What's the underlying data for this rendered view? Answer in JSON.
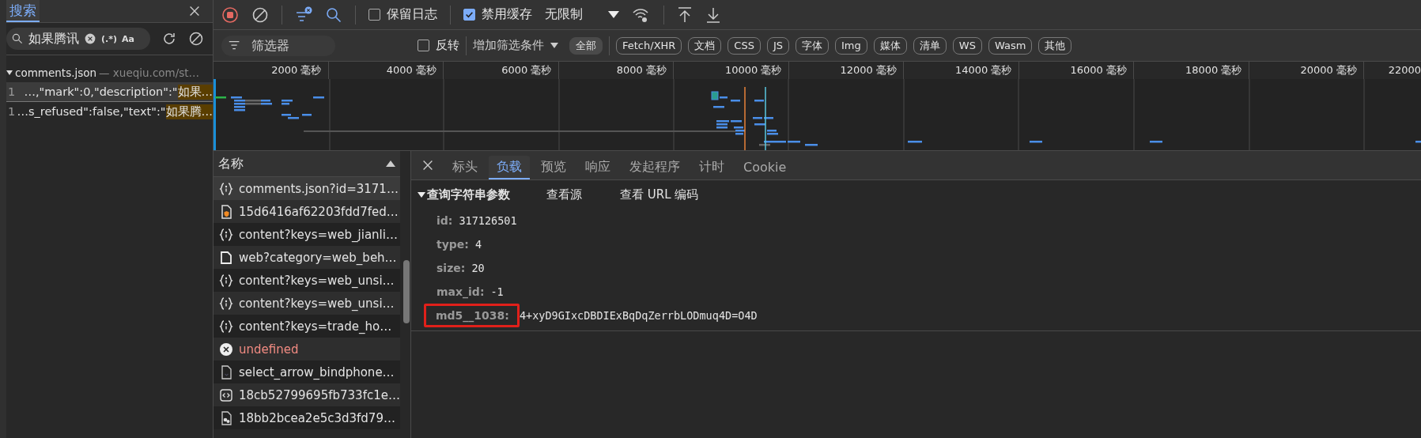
{
  "search_panel": {
    "tabs": [
      {
        "label": "搜索",
        "selected": true
      }
    ],
    "query": "如果腾讯",
    "regex_toggle": "(.*)",
    "case_toggle": "Aa",
    "results": [
      {
        "file": "comments.json",
        "location": "— xueqiu.com/st…",
        "expanded": true,
        "matches": [
          {
            "line": "1",
            "prefix": "…,\"mark\":0,\"description\":\"",
            "match": "如果…",
            "selected": true
          },
          {
            "line": "1",
            "prefix": "…s_refused\":false,\"text\":\"",
            "match": "如果腾…",
            "selected": false
          }
        ]
      }
    ]
  },
  "toolbar": {
    "recording": true,
    "preserve_log": {
      "label": "保留日志",
      "checked": false
    },
    "disable_cache": {
      "label": "禁用缓存",
      "checked": true
    },
    "throttling": "无限制"
  },
  "filter_bar": {
    "placeholder": "筛选器",
    "invert": {
      "label": "反转",
      "checked": false
    },
    "more_filters": "增加筛选条件",
    "types": [
      {
        "label": "全部",
        "selected": true
      },
      {
        "label": "Fetch/XHR",
        "selected": false
      },
      {
        "label": "文档",
        "selected": false
      },
      {
        "label": "CSS",
        "selected": false
      },
      {
        "label": "JS",
        "selected": false
      },
      {
        "label": "字体",
        "selected": false
      },
      {
        "label": "Img",
        "selected": false
      },
      {
        "label": "媒体",
        "selected": false
      },
      {
        "label": "清单",
        "selected": false
      },
      {
        "label": "WS",
        "selected": false
      },
      {
        "label": "Wasm",
        "selected": false
      },
      {
        "label": "其他",
        "selected": false
      }
    ]
  },
  "timeline": {
    "ticks": [
      "2000 毫秒",
      "4000 毫秒",
      "6000 毫秒",
      "8000 毫秒",
      "10000 毫秒",
      "12000 毫秒",
      "14000 毫秒",
      "16000 毫秒",
      "18000 毫秒",
      "20000 毫秒",
      "22000"
    ]
  },
  "requests": {
    "column": "名称",
    "rows": [
      {
        "name": "comments.json?id=3171…",
        "kind": "json",
        "selected": true
      },
      {
        "name": "15d6416af62203fdd7fed…",
        "kind": "image",
        "selected": false
      },
      {
        "name": "content?keys=web_jianli…",
        "kind": "json",
        "selected": false
      },
      {
        "name": "web?category=web_beh…",
        "kind": "document",
        "selected": false
      },
      {
        "name": "content?keys=web_unsi…",
        "kind": "json",
        "selected": false
      },
      {
        "name": "content?keys=web_unsi…",
        "kind": "json",
        "selected": false
      },
      {
        "name": "content?keys=trade_ho…",
        "kind": "json",
        "selected": false
      },
      {
        "name": "undefined",
        "kind": "error",
        "selected": false
      },
      {
        "name": "select_arrow_bindphone…",
        "kind": "file",
        "selected": false
      },
      {
        "name": "18cb52799695fb733fc1e…",
        "kind": "script",
        "selected": false
      },
      {
        "name": "18bb2bcea2e5c3d3fd79…",
        "kind": "picture-file",
        "selected": false
      }
    ]
  },
  "details": {
    "tabs": [
      {
        "label": "标头",
        "selected": false
      },
      {
        "label": "负载",
        "selected": true
      },
      {
        "label": "预览",
        "selected": false
      },
      {
        "label": "响应",
        "selected": false
      },
      {
        "label": "发起程序",
        "selected": false
      },
      {
        "label": "计时",
        "selected": false
      },
      {
        "label": "Cookie",
        "selected": false
      }
    ],
    "section": {
      "title": "查询字符串参数",
      "expanded": true,
      "links": [
        "查看源",
        "查看 URL 编码"
      ],
      "params": [
        {
          "key": "id:",
          "value": "317126501",
          "highlighted": false
        },
        {
          "key": "type:",
          "value": "4",
          "highlighted": false
        },
        {
          "key": "size:",
          "value": "20",
          "highlighted": false
        },
        {
          "key": "max_id:",
          "value": "-1",
          "highlighted": false
        },
        {
          "key": "md5__1038:",
          "value": "4+xyD9GIxcDBDIExBqDqZerrbLODmuq4D=O4D",
          "highlighted": true
        }
      ]
    }
  }
}
